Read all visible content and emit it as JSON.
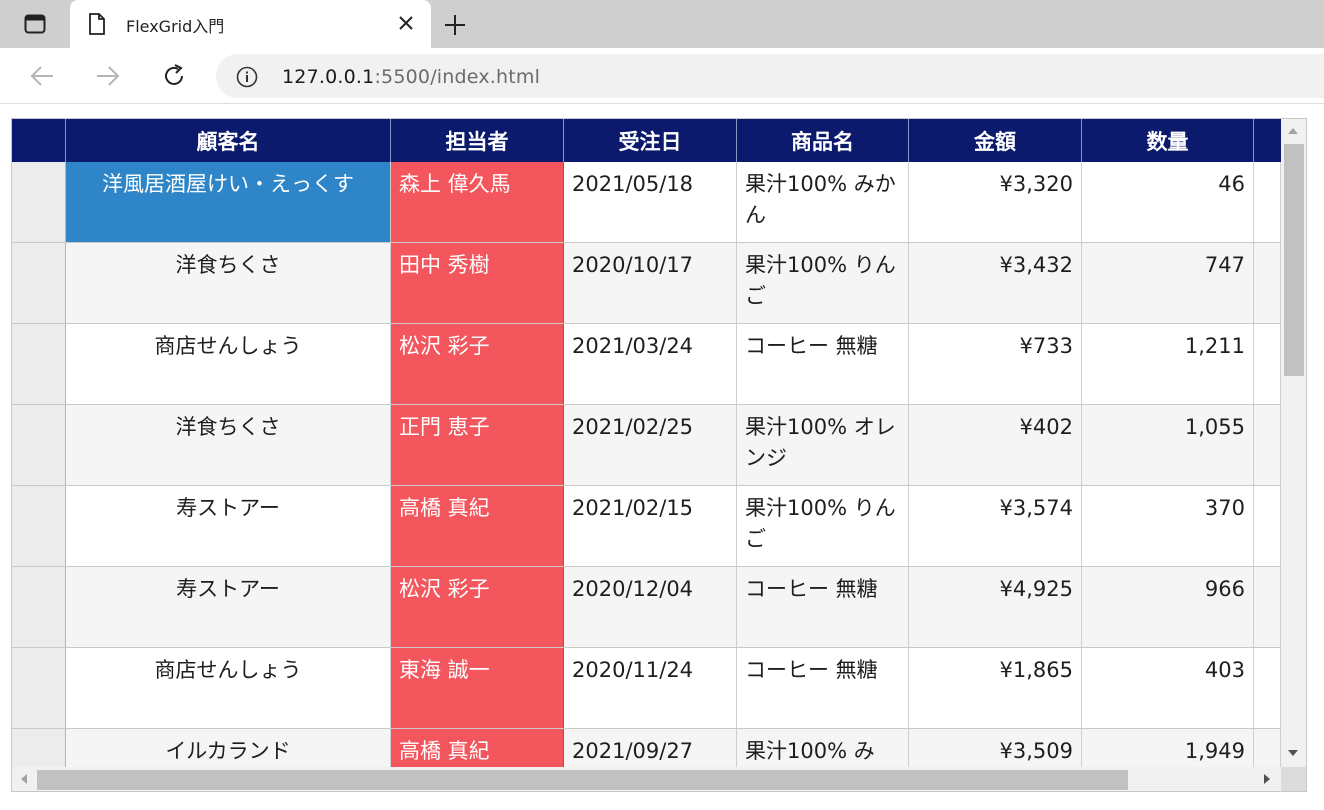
{
  "browser": {
    "tab_title": "FlexGrid入門",
    "url_host": "127.0.0.1",
    "url_rest": ":5500/index.html"
  },
  "grid": {
    "columns": [
      "顧客名",
      "担当者",
      "受注日",
      "商品名",
      "金額",
      "数量"
    ],
    "rows": [
      {
        "customer": "洋風居酒屋けい・えっくす",
        "rep": "森上 偉久馬",
        "date": "2021/05/18",
        "product": "果汁100% みかん",
        "amount": "¥3,320",
        "qty": "46"
      },
      {
        "customer": "洋食ちくさ",
        "rep": "田中 秀樹",
        "date": "2020/10/17",
        "product": "果汁100% りんご",
        "amount": "¥3,432",
        "qty": "747"
      },
      {
        "customer": "商店せんしょう",
        "rep": "松沢 彩子",
        "date": "2021/03/24",
        "product": "コーヒー 無糖",
        "amount": "¥733",
        "qty": "1,211"
      },
      {
        "customer": "洋食ちくさ",
        "rep": "正門 恵子",
        "date": "2021/02/25",
        "product": "果汁100% オレンジ",
        "amount": "¥402",
        "qty": "1,055"
      },
      {
        "customer": "寿ストアー",
        "rep": "高橋 真紀",
        "date": "2021/02/15",
        "product": "果汁100% りんご",
        "amount": "¥3,574",
        "qty": "370"
      },
      {
        "customer": "寿ストアー",
        "rep": "松沢 彩子",
        "date": "2020/12/04",
        "product": "コーヒー 無糖",
        "amount": "¥4,925",
        "qty": "966"
      },
      {
        "customer": "商店せんしょう",
        "rep": "東海 誠一",
        "date": "2020/11/24",
        "product": "コーヒー 無糖",
        "amount": "¥1,865",
        "qty": "403"
      },
      {
        "customer": "イルカランド",
        "rep": "高橋 真紀",
        "date": "2021/09/27",
        "product": "果汁100% み",
        "amount": "¥3,509",
        "qty": "1,949"
      }
    ]
  },
  "colors": {
    "header_bg": "#0b1a6d",
    "rep_column_bg": "#f4565d",
    "selected_cell_bg": "#2e86c8"
  }
}
